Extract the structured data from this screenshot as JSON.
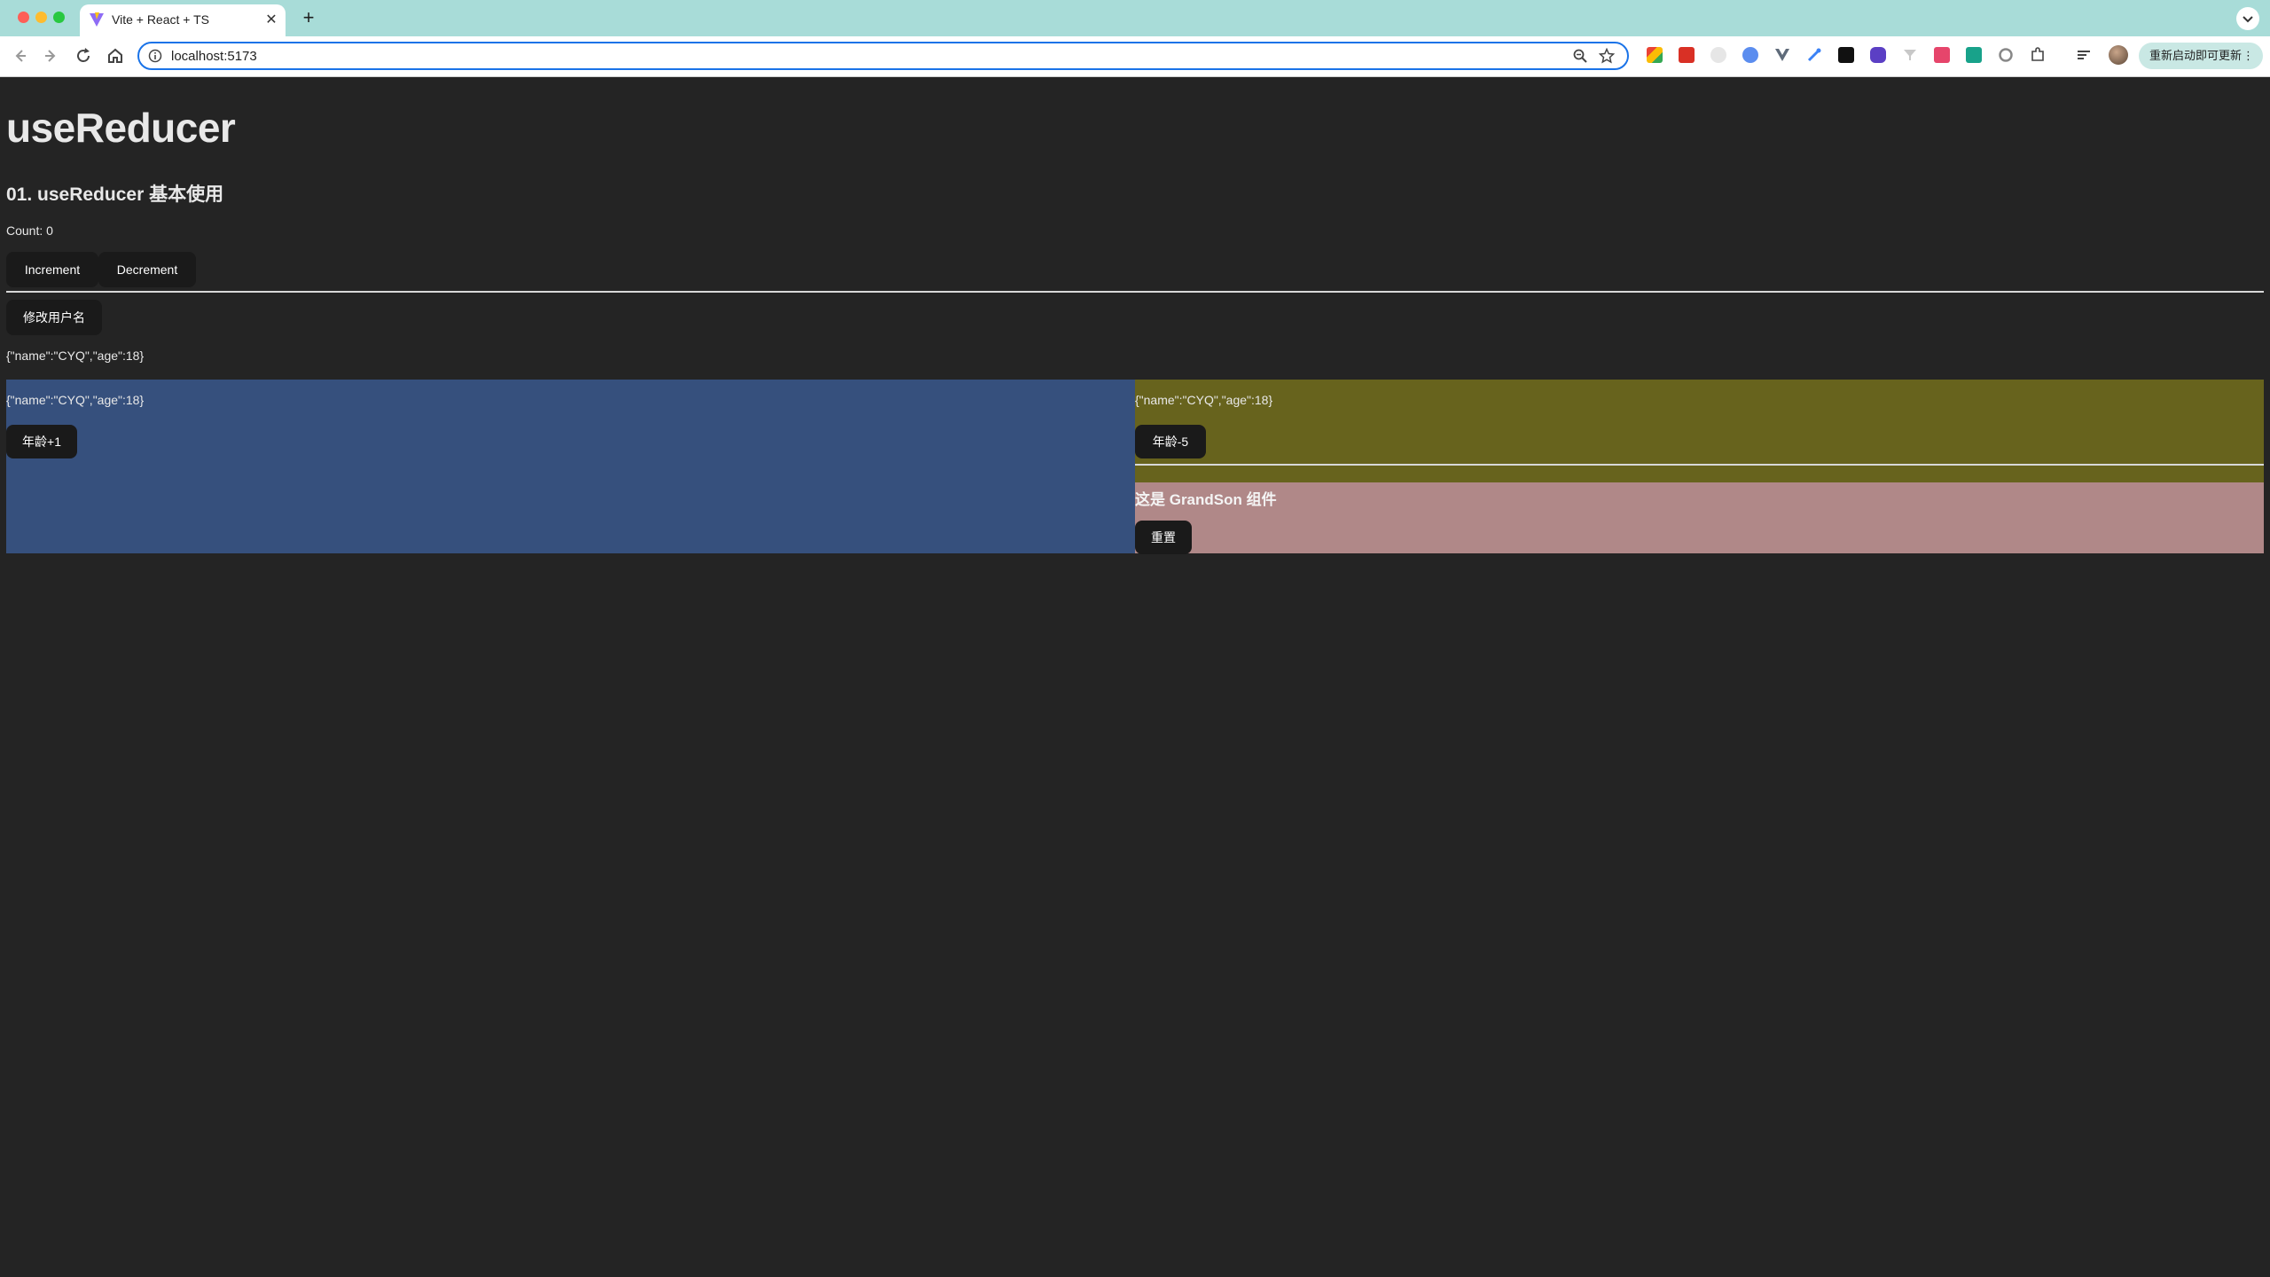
{
  "browser": {
    "tab_title": "Vite + React + TS",
    "url": "localhost:5173",
    "update_button_label": "重新启动即可更新"
  },
  "page": {
    "title": "useReducer",
    "section_heading": "01. useReducer 基本使用",
    "count_text": "Count: 0",
    "increment_label": "Increment",
    "decrement_label": "Decrement",
    "change_username_label": "修改用户名",
    "user_json": "{\"name\":\"CYQ\",\"age\":18}",
    "son1": {
      "user_json": "{\"name\":\"CYQ\",\"age\":18}",
      "button_label": "年龄+1"
    },
    "son2": {
      "user_json": "{\"name\":\"CYQ\",\"age\":18}",
      "button_label": "年龄-5",
      "grandson": {
        "title": "这是 GrandSon 组件",
        "reset_label": "重置"
      }
    }
  },
  "colors": {
    "page_bg": "#242424",
    "son1_bg": "#36507d",
    "son2_bg": "#67631d",
    "grandson_bg": "#b08888",
    "button_bg": "#1a1a1a",
    "tab_strip_bg": "#a8dcd8"
  }
}
